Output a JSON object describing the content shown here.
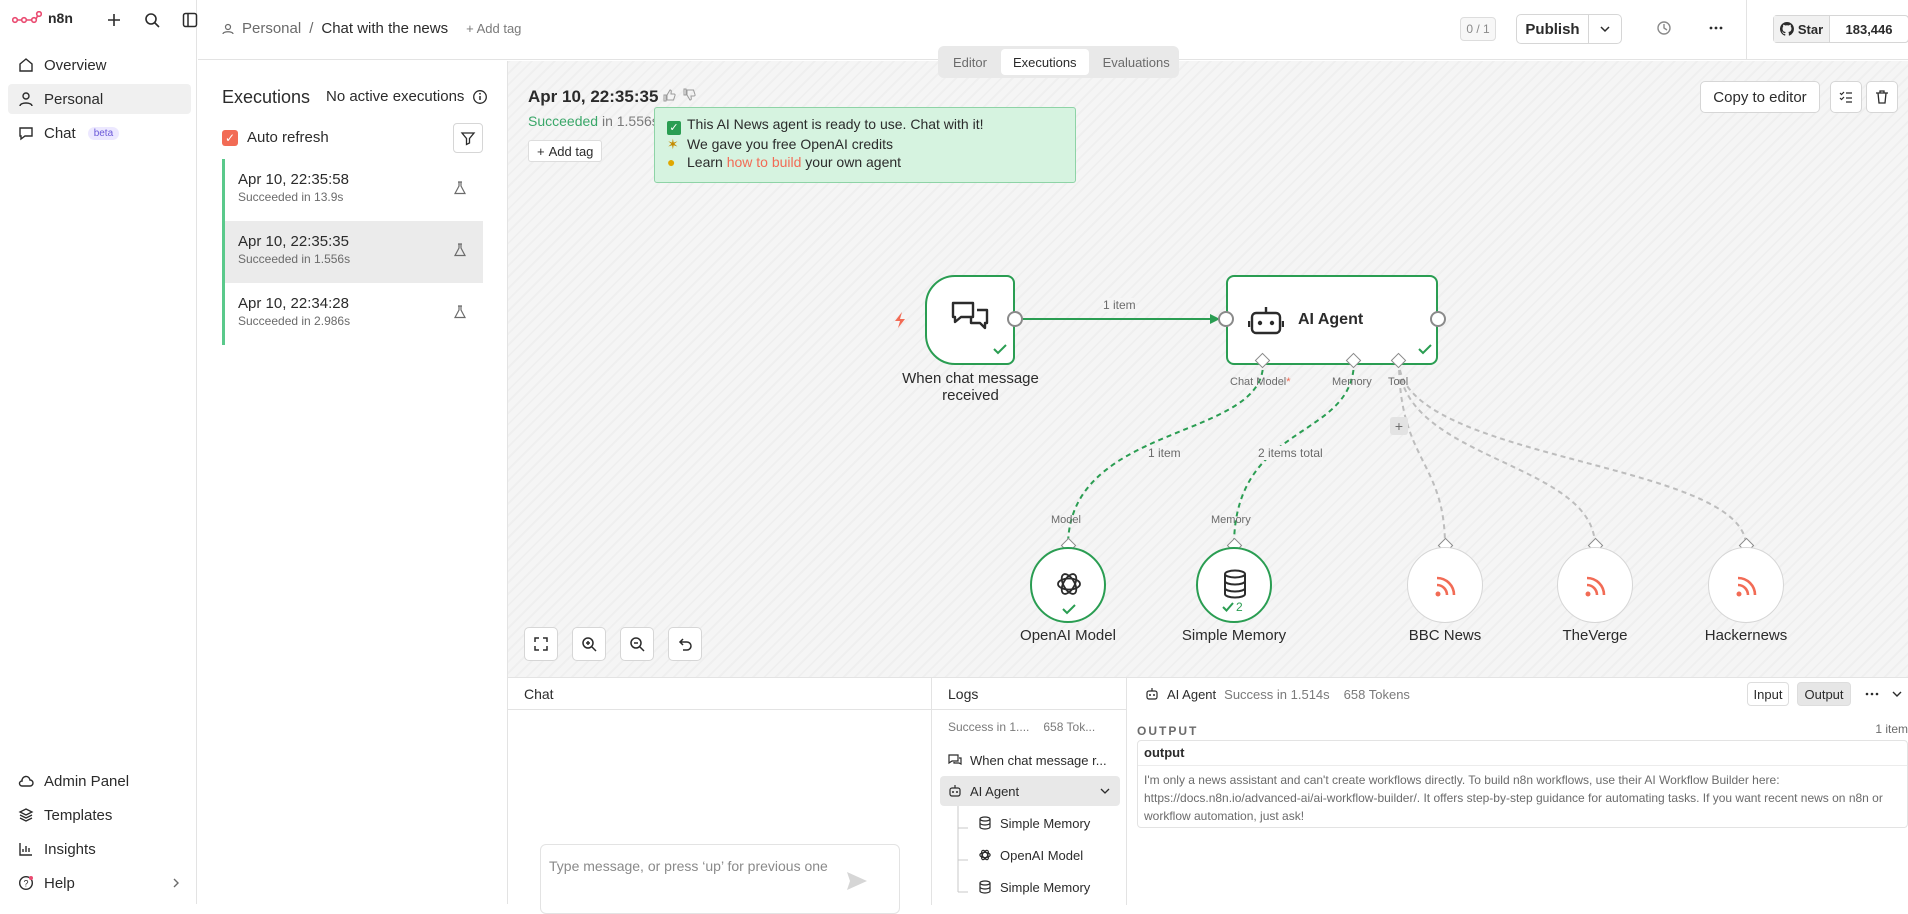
{
  "app": {
    "name": "n8n"
  },
  "sidebar": {
    "items": [
      {
        "label": "Overview"
      },
      {
        "label": "Personal"
      },
      {
        "label": "Chat",
        "badge": "beta"
      }
    ],
    "bottom": [
      {
        "label": "Admin Panel"
      },
      {
        "label": "Templates"
      },
      {
        "label": "Insights"
      },
      {
        "label": "Help"
      }
    ]
  },
  "header": {
    "project": "Personal",
    "separator": "/",
    "workflow": "Chat with the news",
    "add_tag": "+ Add tag",
    "counter": "0 / 1",
    "publish": "Publish",
    "github_star": "Star",
    "github_count": "183,446"
  },
  "tabs": [
    {
      "label": "Editor"
    },
    {
      "label": "Executions",
      "active": true
    },
    {
      "label": "Evaluations"
    }
  ],
  "executions": {
    "title": "Executions",
    "none_active": "No active executions",
    "auto_refresh": "Auto refresh",
    "list": [
      {
        "date": "Apr 10, 22:35:58",
        "status": "Succeeded in 13.9s"
      },
      {
        "date": "Apr 10, 22:35:35",
        "status": "Succeeded in 1.556s",
        "selected": true
      },
      {
        "date": "Apr 10, 22:34:28",
        "status": "Succeeded in 2.986s"
      }
    ]
  },
  "canvas": {
    "date": "Apr 10, 22:35:35",
    "status": "Succeeded",
    "status_detail": "in 1.556s",
    "add_tag": "Add tag",
    "copy_to_editor": "Copy to editor",
    "banner": {
      "line1": "This AI News agent is ready to use. Chat with it!",
      "line2": "We gave you free OpenAI credits",
      "line3_pre": "Learn ",
      "line3_link": "how to build",
      "line3_post": " your own agent"
    },
    "nodes": {
      "trigger": "When chat message received",
      "agent": "AI Agent",
      "openai": "OpenAI Model",
      "memory": "Simple Memory",
      "bbc": "BBC News",
      "verge": "TheVerge",
      "hn": "Hackernews"
    },
    "ports": {
      "chat_model": "Chat Model",
      "memory": "Memory",
      "tool": "Tool",
      "model": "Model",
      "memory_in": "Memory"
    },
    "edges": {
      "main": "1 item",
      "model": "1 item",
      "memory": "2 items total"
    },
    "memory_runs": "2",
    "required_mark": "*"
  },
  "bottom": {
    "chat_title": "Chat",
    "chat_placeholder": "Type message, or press ‘up’ for previous one",
    "logs_title": "Logs",
    "logs_summary_status": "Success in 1....",
    "logs_summary_tokens": "658 Tok...",
    "logs": [
      {
        "label": "When chat message r..."
      },
      {
        "label": "AI Agent"
      },
      {
        "label": "Simple Memory"
      },
      {
        "label": "OpenAI Model"
      },
      {
        "label": "Simple Memory"
      }
    ],
    "output_node": "AI Agent",
    "output_status": "Success in 1.514s",
    "output_tokens": "658 Tokens",
    "input_btn": "Input",
    "output_btn": "Output",
    "output_title": "OUTPUT",
    "output_items": "1 item",
    "output_key": "output",
    "output_value": "I'm only a news assistant and can't create workflows directly. To build n8n workflows, use their AI Workflow Builder here: https://docs.n8n.io/advanced-ai/ai-workflow-builder/. It offers step-by-step guidance for automating tasks. If you want recent news on n8n or workflow automation, just ask!"
  },
  "colors": {
    "accent": "#f26b55",
    "success": "#3aa769",
    "banner_bg": "#d6f3e0"
  }
}
